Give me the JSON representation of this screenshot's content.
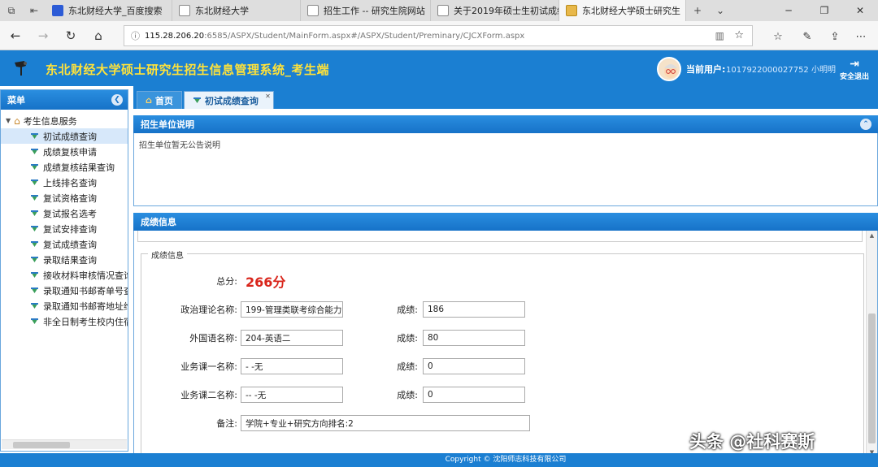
{
  "browser": {
    "tabs": [
      {
        "label": "东北财经大学_百度搜索",
        "active": false
      },
      {
        "label": "东北财经大学",
        "active": false
      },
      {
        "label": "招生工作 -- 研究生院网站",
        "active": false
      },
      {
        "label": "关于2019年硕士生初试成绩",
        "active": false
      },
      {
        "label": "东北财经大学硕士研究生",
        "active": true
      }
    ],
    "new_tab_glyph": "+",
    "tab_list_glyph": "⌄",
    "url_host": "115.28.206.20",
    "url_path": ":6585/ASPX/Student/MainForm.aspx#/ASPX/Student/Preminary/CJCXForm.aspx"
  },
  "app": {
    "title": "东北财经大学硕士研究生招生信息管理系统_考生端",
    "current_user_label": "当前用户:",
    "current_user_value": "1017922000027752 小明明",
    "logout_label": "安全退出"
  },
  "sidebar": {
    "header": "菜单",
    "group": "考生信息服务",
    "items": [
      "初试成绩查询",
      "成绩复核申请",
      "成绩复核结果查询",
      "上线排名查询",
      "复试资格查询",
      "复试报名选考",
      "复试安排查询",
      "复试成绩查询",
      "录取结果查询",
      "接收材料审核情况查询",
      "录取通知书邮寄单号查询",
      "录取通知书邮寄地址维护",
      "非全日制考生校内住宿申请"
    ],
    "selected_index": 0
  },
  "main_tabs": [
    {
      "label": "首页",
      "icon": "home-icon"
    },
    {
      "label": "初试成绩查询",
      "icon": "medal-icon"
    }
  ],
  "notice": {
    "title": "招生单位说明",
    "body": "招生单位暂无公告说明"
  },
  "scores": {
    "panel_title": "成绩信息",
    "fieldset_legend": "成绩信息",
    "total_label": "总分:",
    "total_value": "266分",
    "rows": [
      {
        "name_label": "政治理论名称:",
        "name_value": "199-管理类联考综合能力",
        "score_label": "成绩:",
        "score_value": "186"
      },
      {
        "name_label": "外国语名称:",
        "name_value": "204-英语二",
        "score_label": "成绩:",
        "score_value": "80"
      },
      {
        "name_label": "业务课一名称:",
        "name_value": "- -无",
        "score_label": "成绩:",
        "score_value": "0"
      },
      {
        "name_label": "业务课二名称:",
        "name_value": "-- -无",
        "score_label": "成绩:",
        "score_value": "0"
      }
    ],
    "remark_label": "备注:",
    "remark_value": "学院+专业+研究方向排名:2"
  },
  "footer": "Copyright © 沈阳师志科技有限公司",
  "watermark": "头条 @社科赛斯",
  "colors": {
    "header_blue": "#1b7fd2",
    "title_yellow": "#ffe23a",
    "total_red": "#d9261c"
  }
}
